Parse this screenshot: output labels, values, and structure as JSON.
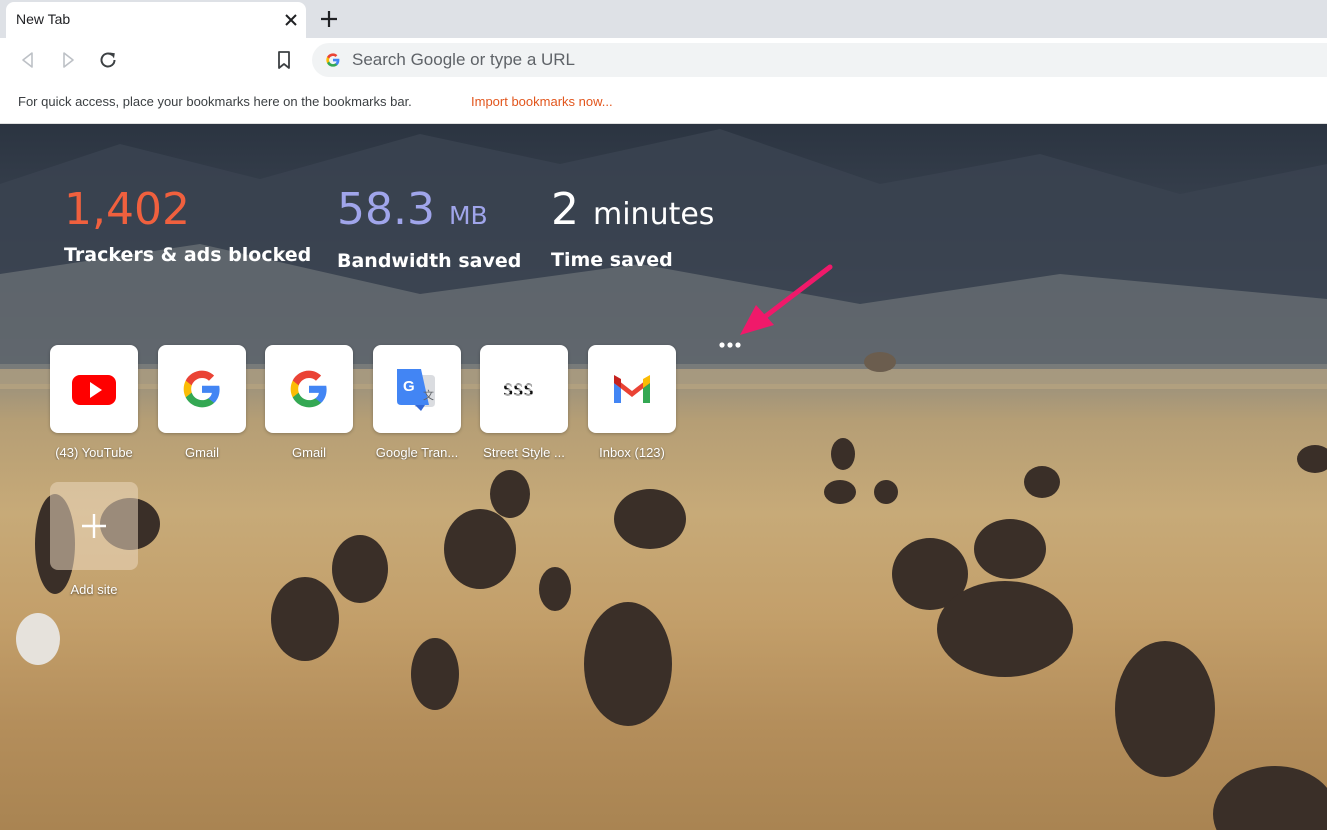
{
  "browser": {
    "tab_title": "New Tab",
    "omnibox_placeholder": "Search Google or type a URL"
  },
  "bookmarks_bar": {
    "hint": "For quick access, place your bookmarks here on the bookmarks bar.",
    "import_link": "Import bookmarks now..."
  },
  "stats": [
    {
      "value": "1,402",
      "unit": "",
      "label": "Trackers & ads blocked",
      "color": "#f0603e"
    },
    {
      "value": "58.3",
      "unit": "MB",
      "label": "Bandwidth saved",
      "color": "#a0a5eb"
    },
    {
      "value": "2",
      "unit": "minutes",
      "label": "Time saved",
      "color": "#ffffff"
    }
  ],
  "top_sites": [
    {
      "label": "(43) YouTube",
      "icon": "youtube-icon"
    },
    {
      "label": "Gmail",
      "icon": "google-icon"
    },
    {
      "label": "Gmail",
      "icon": "google-icon"
    },
    {
      "label": "Google Tran...",
      "icon": "google-translate-icon"
    },
    {
      "label": "Street Style ...",
      "icon": "street-style-icon"
    },
    {
      "label": "Inbox (123)",
      "icon": "gmail-icon"
    }
  ],
  "add_site_label": "Add site",
  "colors": {
    "annotation_arrow": "#f0196a",
    "link": "#e2561d",
    "tab_strip": "#dee1e6"
  }
}
